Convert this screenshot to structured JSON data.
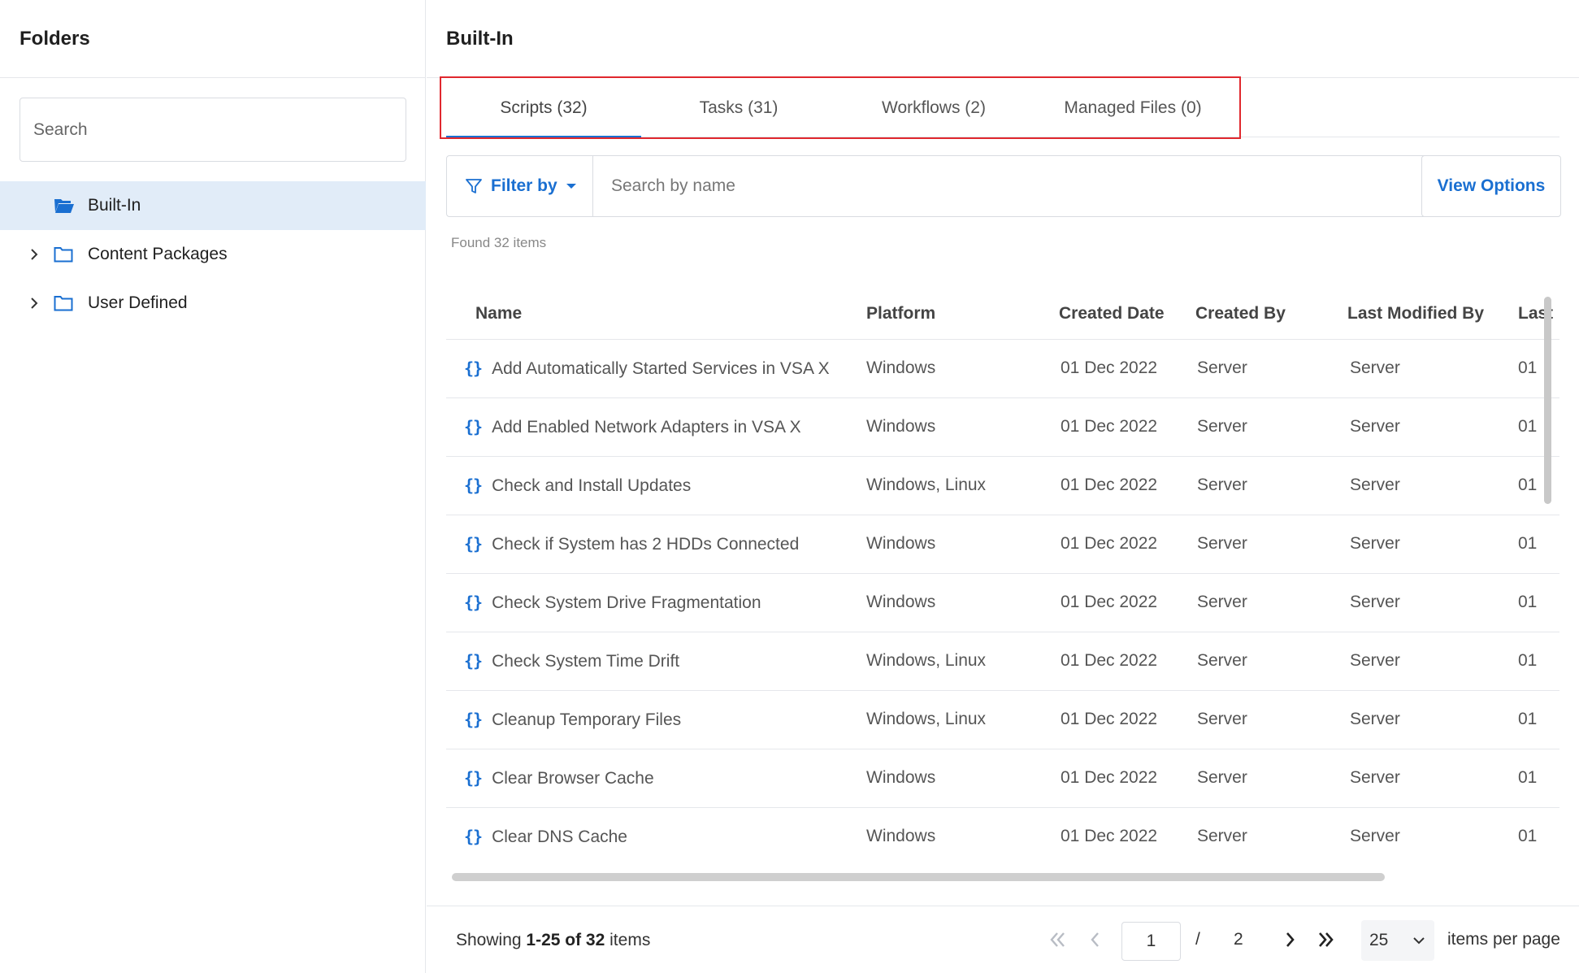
{
  "sidebar": {
    "title": "Folders",
    "search_placeholder": "Search",
    "items": [
      {
        "label": "Built-In",
        "selected": true,
        "expandable": false,
        "icon": "folder-open-icon"
      },
      {
        "label": "Content Packages",
        "selected": false,
        "expandable": true,
        "icon": "folder-icon"
      },
      {
        "label": "User Defined",
        "selected": false,
        "expandable": true,
        "icon": "folder-icon"
      }
    ]
  },
  "main": {
    "title": "Built-In",
    "tabs": [
      {
        "label": "Scripts (32)",
        "active": true
      },
      {
        "label": "Tasks (31)",
        "active": false
      },
      {
        "label": "Workflows (2)",
        "active": false
      },
      {
        "label": "Managed Files (0)",
        "active": false
      }
    ],
    "filter_label": "Filter by",
    "search_placeholder": "Search by name",
    "view_options_label": "View Options",
    "found_text": "Found 32 items"
  },
  "table": {
    "columns": [
      "Name",
      "Platform",
      "Created Date",
      "Created By",
      "Last Modified By",
      "Last"
    ],
    "rows": [
      {
        "name": "Add Automatically Started Services in VSA X",
        "platform": "Windows",
        "created": "01 Dec 2022",
        "created_by": "Server",
        "modified_by": "Server",
        "last": "01"
      },
      {
        "name": "Add Enabled Network Adapters in VSA X",
        "platform": "Windows",
        "created": "01 Dec 2022",
        "created_by": "Server",
        "modified_by": "Server",
        "last": "01"
      },
      {
        "name": "Check and Install Updates",
        "platform": "Windows, Linux",
        "created": "01 Dec 2022",
        "created_by": "Server",
        "modified_by": "Server",
        "last": "01"
      },
      {
        "name": "Check if System has 2 HDDs Connected",
        "platform": "Windows",
        "created": "01 Dec 2022",
        "created_by": "Server",
        "modified_by": "Server",
        "last": "01"
      },
      {
        "name": "Check System Drive Fragmentation",
        "platform": "Windows",
        "created": "01 Dec 2022",
        "created_by": "Server",
        "modified_by": "Server",
        "last": "01"
      },
      {
        "name": "Check System Time Drift",
        "platform": "Windows, Linux",
        "created": "01 Dec 2022",
        "created_by": "Server",
        "modified_by": "Server",
        "last": "01"
      },
      {
        "name": "Cleanup Temporary Files",
        "platform": "Windows, Linux",
        "created": "01 Dec 2022",
        "created_by": "Server",
        "modified_by": "Server",
        "last": "01"
      },
      {
        "name": "Clear Browser Cache",
        "platform": "Windows",
        "created": "01 Dec 2022",
        "created_by": "Server",
        "modified_by": "Server",
        "last": "01"
      },
      {
        "name": "Clear DNS Cache",
        "platform": "Windows",
        "created": "01 Dec 2022",
        "created_by": "Server",
        "modified_by": "Server",
        "last": "01"
      }
    ]
  },
  "footer": {
    "showing_prefix": "Showing",
    "showing_range": "1-25 of 32",
    "showing_suffix": "items",
    "current_page": "1",
    "page_separator": "/",
    "total_pages": "2",
    "per_page_value": "25",
    "per_page_label": "items per page"
  },
  "colors": {
    "accent": "#1a6fd1",
    "selected_bg": "#e1ecf8",
    "highlight_border": "#e0282e",
    "border": "#e5e7eb"
  }
}
